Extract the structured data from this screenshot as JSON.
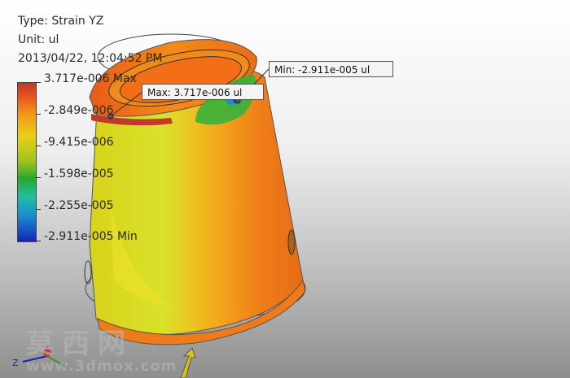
{
  "result_info": {
    "type": "Type: Strain YZ",
    "unit": "Unit: ul",
    "timestamp": "2013/04/22, 12:04:52 PM"
  },
  "legend": {
    "labels": [
      "3.717e-006 Max",
      "-2.849e-006",
      "-9.415e-006",
      "-1.598e-005",
      "-2.255e-005",
      "-2.911e-005 Min"
    ],
    "colors": [
      "#c0392b",
      "#e8501c",
      "#f19a19",
      "#e6d117",
      "#9cc221",
      "#28a830",
      "#1fc0a2",
      "#1c8bd0",
      "#1424b8"
    ]
  },
  "probes": {
    "min": "Min: -2.911e-005 ul",
    "max": "Max: 3.717e-006 ul"
  },
  "axis_triad": {
    "z_label": "Z"
  },
  "watermark": {
    "chinese": "莫西网",
    "url": "www.3dmox.com"
  }
}
